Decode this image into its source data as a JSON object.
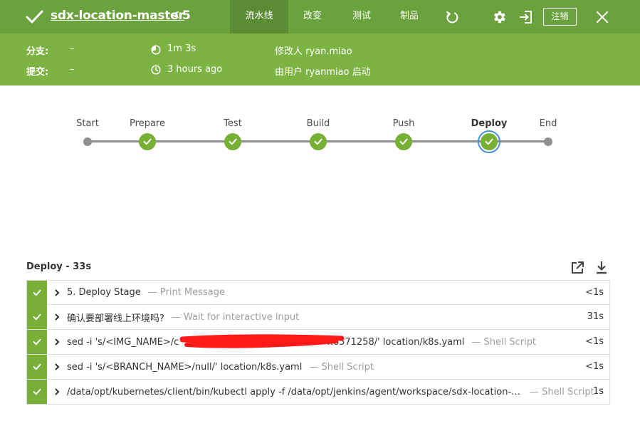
{
  "header": {
    "title": "sdx-location-master",
    "back_glyph": "<",
    "run_number": "5",
    "tabs": [
      {
        "label": "流水线",
        "active": true
      },
      {
        "label": "改变",
        "active": false
      },
      {
        "label": "测试",
        "active": false
      },
      {
        "label": "制品",
        "active": false
      }
    ],
    "logout_label": "注销",
    "icons": [
      "success-check-icon",
      "replay-icon",
      "settings-gear-icon",
      "exit-icon",
      "close-icon"
    ]
  },
  "meta": {
    "branch_label": "分支:",
    "branch_value": "–",
    "commit_label": "提交:",
    "commit_value": "–",
    "duration": "1m 3s",
    "time_ago": "3 hours ago",
    "changed_by": "修改人 ryan.miao",
    "started_by": "由用户 ryanmiao 启动"
  },
  "pipeline": {
    "stages": [
      {
        "name": "Start",
        "status": "start"
      },
      {
        "name": "Prepare",
        "status": "success"
      },
      {
        "name": "Test",
        "status": "success"
      },
      {
        "name": "Build",
        "status": "success"
      },
      {
        "name": "Push",
        "status": "success"
      },
      {
        "name": "Deploy",
        "status": "success",
        "selected": true
      },
      {
        "name": "End",
        "status": "end"
      }
    ]
  },
  "log": {
    "title": "Deploy - 33s",
    "steps": [
      {
        "text": "5. Deploy Stage",
        "type": "— Print Message",
        "duration": "<1s",
        "status": "success"
      },
      {
        "text": "确认要部署线上环境吗?",
        "type": "— Wait for interactive input",
        "duration": "31s",
        "status": "success"
      },
      {
        "text": "sed -i 's/<IMG_NAME>/c",
        "text_tail": ":.6571258/' location/k8s.yaml",
        "type": "— Shell Script",
        "duration": "<1s",
        "status": "success",
        "redacted": true
      },
      {
        "text": "sed -i 's/<BRANCH_NAME>/null/' location/k8s.yaml",
        "type": "— Shell Script",
        "duration": "<1s",
        "status": "success"
      },
      {
        "text": "/data/opt/kubernetes/client/bin/kubectl apply -f /data/opt/jenkins/agent/workspace/sdx-location-m...",
        "type": "— Shell Script",
        "duration": "1s",
        "status": "success"
      }
    ]
  },
  "colors": {
    "header_bg": "#6aa33e",
    "meta_bg": "#7cb342",
    "success": "#78b037",
    "selected_ring": "#4a90d9"
  }
}
